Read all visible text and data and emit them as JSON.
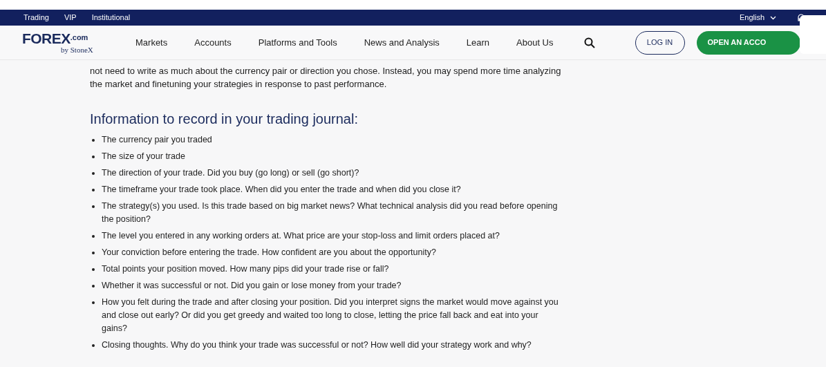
{
  "top_bar": {
    "links": [
      "Trading",
      "VIP",
      "Institutional"
    ],
    "language": "English"
  },
  "nav": {
    "logo": {
      "brand": "FOREX",
      "suffix": ".com",
      "byline": "by StoneX"
    },
    "items": [
      "Markets",
      "Accounts",
      "Platforms and Tools",
      "News and Analysis",
      "Learn",
      "About Us"
    ],
    "login": "LOG IN",
    "open_account": "OPEN AN ACCO"
  },
  "article": {
    "intro": "not need to write as much about the currency pair or direction you chose. Instead, you may spend more time analyzing the market and finetuning your strategies in response to past performance.",
    "heading": "Information to record in your trading journal:",
    "bullets": [
      "The currency pair you traded",
      "The size of your trade",
      "The direction of your trade. Did you buy (go long) or sell (go short)?",
      "The timeframe your trade took place. When did you enter the trade and when did you close it?",
      "The strategy(s) you used. Is this trade based on big market news? What technical analysis did you read before opening the position?",
      "The level you entered in any working orders at. What price are your stop-loss and limit orders placed at?",
      "Your conviction before entering the trade. How confident are you about the opportunity?",
      "Total points your position moved. How many pips did your trade rise or fall?",
      "Whether it was successful or not. Did you gain or lose money from your trade?",
      "How you felt during the trade and after closing your position. Did you interpret signs the market would move against you and close out early? Or did you get greedy and waited too long to close, letting the price fall back and eat into your gains?",
      "Closing thoughts. Why do you think your trade was successful or not? How well did your strategy work and why?"
    ]
  }
}
